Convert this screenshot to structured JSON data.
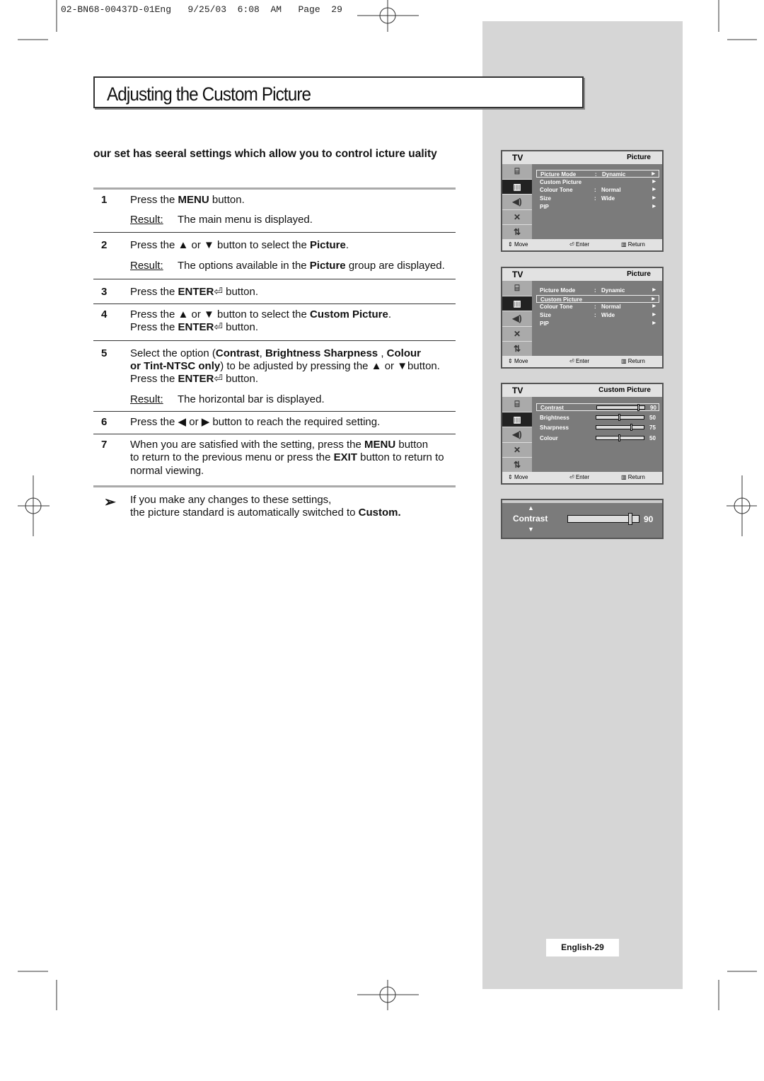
{
  "header_line": "02-BN68-00437D-01Eng   9/25/03  6:08  AM   Page  29",
  "title": "Adjusting the Custom Picture",
  "intro": "our set has seeral settings which allow you to control icture uality",
  "result_label": "Result",
  "steps": [
    {
      "num": "1",
      "lines": [
        [
          {
            "t": "Press the "
          },
          {
            "t": "MENU",
            "b": 1
          },
          {
            "t": " button."
          }
        ]
      ],
      "result": "The main menu is displayed."
    },
    {
      "num": "2",
      "lines": [
        [
          {
            "t": "Press the ▲ or ▼ button to select the "
          },
          {
            "t": "Picture",
            "b": 1
          },
          {
            "t": "."
          }
        ]
      ],
      "result_parts": [
        {
          "t": "The options available in the "
        },
        {
          "t": "Picture",
          "b": 1
        },
        {
          "t": " group are displayed."
        }
      ]
    },
    {
      "num": "3",
      "lines": [
        [
          {
            "t": "Press the "
          },
          {
            "t": "ENTER",
            "b": 1
          },
          {
            "t": "⏎ "
          },
          {
            "t": " button."
          }
        ]
      ]
    },
    {
      "num": "4",
      "lines": [
        [
          {
            "t": "Press the ▲ or ▼ button to select the "
          },
          {
            "t": "Custom Picture",
            "b": 1
          },
          {
            "t": "."
          }
        ],
        [
          {
            "t": "Press the "
          },
          {
            "t": "ENTER",
            "b": 1
          },
          {
            "t": "⏎ "
          },
          {
            "t": " button."
          }
        ]
      ]
    },
    {
      "num": "5",
      "lines": [
        [
          {
            "t": "Select the option ("
          },
          {
            "t": "Contrast",
            "b": 1
          },
          {
            "t": ", "
          },
          {
            "t": "Brightness Sharpness",
            "b": 1
          },
          {
            "t": " , "
          },
          {
            "t": "Colour",
            "b": 1
          }
        ],
        [
          {
            "t": "or Tint-NTSC only",
            "b": 1
          },
          {
            "t": ") to be adjusted by pressing the ▲ or ▼button."
          }
        ],
        [
          {
            "t": "Press the "
          },
          {
            "t": "ENTER",
            "b": 1
          },
          {
            "t": "⏎ "
          },
          {
            "t": " button."
          }
        ]
      ],
      "result": "The horizontal bar is displayed."
    },
    {
      "num": "6",
      "lines": [
        [
          {
            "t": "Press the ◀ or ▶ button to reach the required setting."
          }
        ]
      ]
    },
    {
      "num": "7",
      "lines": [
        [
          {
            "t": "When you are satisfied with the setting, press the "
          },
          {
            "t": "MENU",
            "b": 1
          },
          {
            "t": " button"
          }
        ],
        [
          {
            "t": "to return to the previous menu or press the "
          },
          {
            "t": "EXIT",
            "b": 1
          },
          {
            "t": " button to return to"
          }
        ],
        [
          {
            "t": "normal viewing."
          }
        ]
      ]
    }
  ],
  "note": {
    "icon": "arrow-pointer-icon",
    "lines": [
      [
        {
          "t": "If you make any changes to these settings,"
        }
      ],
      [
        {
          "t": "the picture standard is automatically switched to "
        },
        {
          "t": "Custom.",
          "b": 1
        }
      ]
    ]
  },
  "menus": [
    {
      "tv": "TV",
      "title": "Picture",
      "highlight": 0,
      "rows": [
        {
          "label": "Picture Mode",
          "value": "Dynamic"
        },
        {
          "label": "Custom Picture",
          "value": ""
        },
        {
          "label": "Colour Tone",
          "value": "Normal"
        },
        {
          "label": "Size",
          "value": "Wide"
        },
        {
          "label": "PIP",
          "value": ""
        }
      ]
    },
    {
      "tv": "TV",
      "title": "Picture",
      "highlight": 1,
      "rows": [
        {
          "label": "Picture Mode",
          "value": "Dynamic"
        },
        {
          "label": "Custom Picture",
          "value": ""
        },
        {
          "label": "Colour Tone",
          "value": "Normal"
        },
        {
          "label": "Size",
          "value": "Wide"
        },
        {
          "label": "PIP",
          "value": ""
        }
      ]
    },
    {
      "tv": "TV",
      "title": "Custom Picture",
      "highlight": 0,
      "sliders": [
        {
          "label": "Contrast",
          "value": "90"
        },
        {
          "label": "Brightness",
          "value": "50"
        },
        {
          "label": "Sharpness",
          "value": "75"
        },
        {
          "label": "Colour",
          "value": "50"
        }
      ]
    }
  ],
  "footer": {
    "move": "Move",
    "enter": "Enter",
    "return": "Return"
  },
  "menu_icons": [
    "antenna-input-icon",
    "picture-icon",
    "sound-icon",
    "channel-satellite-icon",
    "setup-icon"
  ],
  "contrast_bar": {
    "label": "Contrast",
    "value": "90"
  },
  "page_label": "English-29"
}
